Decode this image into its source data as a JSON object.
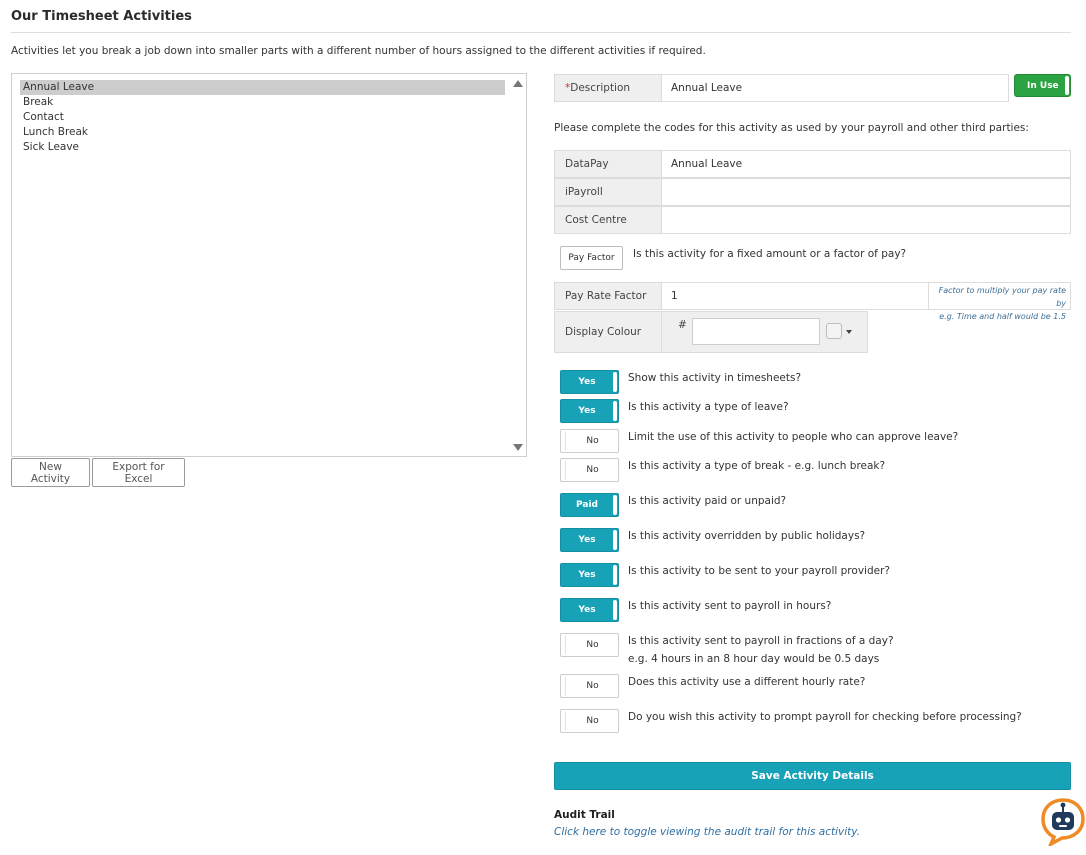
{
  "page": {
    "title": "Our Timesheet Activities",
    "intro": "Activities let you break a job down into smaller parts with a different number of hours assigned to the different activities if required."
  },
  "activities": [
    "Annual Leave",
    "Break",
    "Contact",
    "Lunch Break",
    "Sick Leave"
  ],
  "selected_activity": "Annual Leave",
  "buttons": {
    "new_activity": "New Activity",
    "export": "Export for Excel",
    "save": "Save Activity Details"
  },
  "form": {
    "description_required": "*",
    "description_label": "Description",
    "description_value": "Annual Leave",
    "in_use_label": "In Use",
    "codes_note": "Please complete the codes for this activity as used by your payroll and other third parties:",
    "codes": [
      {
        "label": "DataPay",
        "value": "Annual Leave"
      },
      {
        "label": "iPayroll",
        "value": ""
      },
      {
        "label": "Cost Centre",
        "value": ""
      }
    ],
    "pay_type_button": "Pay Factor",
    "pay_type_question": "Is this activity for a fixed amount or a factor of pay?",
    "pay_rate_factor_label": "Pay Rate Factor",
    "pay_rate_factor_value": "1",
    "pay_rate_hint_line1": "Factor to multiply your pay rate by",
    "pay_rate_hint_line2": "e.g. Time and half would be 1.5",
    "display_colour_label": "Display Colour",
    "colour_hash": "#",
    "colour_value": ""
  },
  "toggles": [
    {
      "state": "Yes",
      "on": true,
      "question": "Show this activity in timesheets?"
    },
    {
      "state": "Yes",
      "on": true,
      "question": "Is this activity a type of leave?"
    },
    {
      "state": "No",
      "on": false,
      "question": "Limit the use of this activity to people who can approve leave?"
    },
    {
      "state": "No",
      "on": false,
      "question": "Is this activity a type of break - e.g. lunch break?"
    },
    {
      "state": "Paid",
      "on": true,
      "question": "Is this activity paid or unpaid?"
    },
    {
      "state": "Yes",
      "on": true,
      "question": "Is this activity overridden by public holidays?"
    },
    {
      "state": "Yes",
      "on": true,
      "question": "Is this activity to be sent to your payroll provider?"
    },
    {
      "state": "Yes",
      "on": true,
      "question": "Is this activity sent to payroll in hours?"
    },
    {
      "state": "No",
      "on": false,
      "question": "Is this activity sent to payroll in fractions of a day?",
      "question_line2": "e.g. 4 hours in an 8 hour day would be 0.5 days"
    },
    {
      "state": "No",
      "on": false,
      "question": "Does this activity use a different hourly rate?"
    },
    {
      "state": "No",
      "on": false,
      "question": "Do you wish this activity to prompt payroll for checking before processing?"
    }
  ],
  "audit": {
    "title": "Audit Trail",
    "link": "Click here to toggle viewing the audit trail for this activity."
  },
  "colors": {
    "accent": "#17a2b8",
    "in_use": "#2ca342",
    "required": "#d9232e",
    "link": "#2f6fa3"
  }
}
